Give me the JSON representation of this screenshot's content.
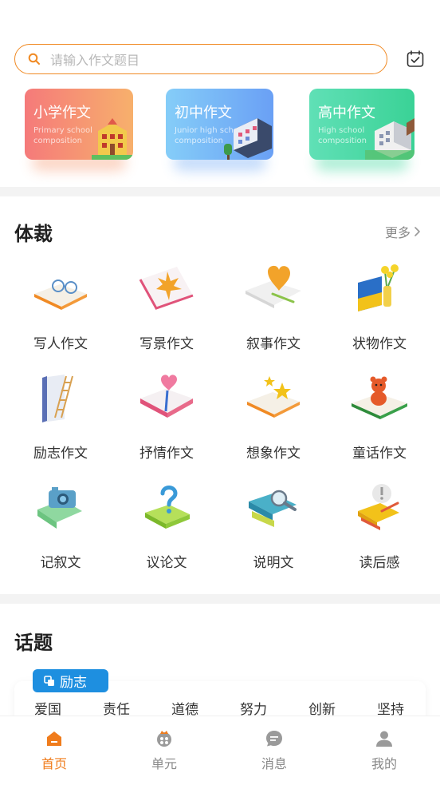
{
  "search": {
    "placeholder": "请输入作文题目"
  },
  "icons": {
    "search": "search-icon",
    "calendar": "calendar-check-icon"
  },
  "grades": [
    {
      "title": "小学作文",
      "subtitle": "Primary school composition",
      "colors": [
        "#f57a7a",
        "#f7b06c"
      ]
    },
    {
      "title": "初中作文",
      "subtitle": "Junior high school composition",
      "colors": [
        "#7ec8f8",
        "#6aa2f5"
      ]
    },
    {
      "title": "高中作文",
      "subtitle": "High school composition",
      "colors": [
        "#5fe0b2",
        "#3ed39a"
      ]
    }
  ],
  "genre_section": {
    "title": "体裁",
    "more": "更多",
    "items": [
      {
        "label": "写人作文",
        "icon": "glasses-book-icon"
      },
      {
        "label": "写景作文",
        "icon": "maple-leaf-book-icon"
      },
      {
        "label": "叙事作文",
        "icon": "heart-letter-icon"
      },
      {
        "label": "状物作文",
        "icon": "flowers-book-icon"
      },
      {
        "label": "励志作文",
        "icon": "ladder-book-icon"
      },
      {
        "label": "抒情作文",
        "icon": "heart-book-icon"
      },
      {
        "label": "想象作文",
        "icon": "star-book-icon"
      },
      {
        "label": "童话作文",
        "icon": "teddy-bear-book-icon"
      },
      {
        "label": "记叙文",
        "icon": "camera-map-icon"
      },
      {
        "label": "议论文",
        "icon": "question-book-icon"
      },
      {
        "label": "说明文",
        "icon": "magnifier-book-icon"
      },
      {
        "label": "读后感",
        "icon": "exclamation-books-icon"
      }
    ]
  },
  "topic_section": {
    "title": "话题",
    "badge": "励志",
    "tags": [
      "爱国",
      "责任",
      "道德",
      "努力",
      "创新",
      "坚持"
    ]
  },
  "tabbar": {
    "active_color": "#f07c1c",
    "items": [
      {
        "label": "首页",
        "icon": "home-icon",
        "active": true
      },
      {
        "label": "单元",
        "icon": "unit-icon",
        "active": false
      },
      {
        "label": "消息",
        "icon": "message-icon",
        "active": false
      },
      {
        "label": "我的",
        "icon": "profile-icon",
        "active": false
      }
    ]
  }
}
